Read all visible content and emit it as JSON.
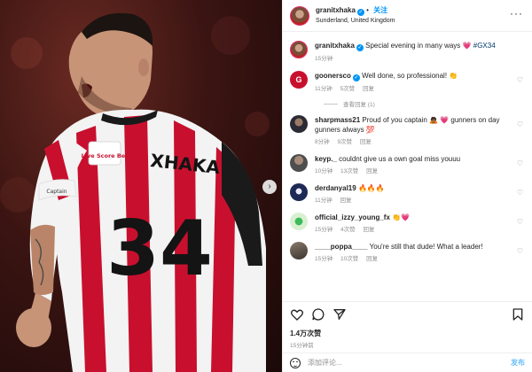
{
  "photo": {
    "jersey_name": "XHAKA",
    "jersey_number": "34",
    "sleeve_sponsor": "Live Score Bet",
    "armband": "Captain"
  },
  "header": {
    "username": "granitxhaka",
    "follow_label": "关注",
    "location": "Sunderland, United Kingdom",
    "more_icon": "more-horizontal-icon"
  },
  "caption": {
    "username": "granitxhaka",
    "text": "Special evening in many ways",
    "emoji": "💗",
    "hashtag": "#GX34",
    "time": "15分钟"
  },
  "comments": [
    {
      "username": "goonersco",
      "text": "Well done, so professional!",
      "emoji": "👏",
      "time": "11分钟",
      "likes": "5次赞",
      "reply": "回复"
    },
    {
      "username": "sharpmass21",
      "text": "Proud of you captain 🙇🏾 💗 gunners on day gunners always 💯",
      "time": "8分钟",
      "likes": "9次赞",
      "reply": "回复"
    },
    {
      "username": "keyp._",
      "text": "couldnt give us a own goal miss youuu",
      "time": "10分钟",
      "likes": "13次赞",
      "reply": "回复"
    },
    {
      "username": "derdanyal19",
      "text": "🔥🔥🔥",
      "time": "11分钟",
      "likes": "",
      "reply": "回复"
    },
    {
      "username": "official_izzy_young_fx",
      "text": "👏💗",
      "time": "15分钟",
      "likes": "4次赞",
      "reply": "回复"
    },
    {
      "username": "____poppa____",
      "text": "You're still that dude! What a leader!",
      "time": "15分钟",
      "likes": "10次赞",
      "reply": "回复"
    }
  ],
  "view_replies_label": "查看回复 (1)",
  "goonersco_avatar_text": "G",
  "actions": {
    "like_icon": "heart-icon",
    "comment_icon": "comment-icon",
    "share_icon": "send-icon",
    "save_icon": "bookmark-icon"
  },
  "likes_count": "1.4万次赞",
  "post_time": "15分钟前",
  "add_comment": {
    "placeholder": "添加评论...",
    "post_label": "发布"
  },
  "colors": {
    "accent_blue": "#0095f6",
    "heart_pink": "#e1306c",
    "jersey_red": "#c8102e"
  }
}
